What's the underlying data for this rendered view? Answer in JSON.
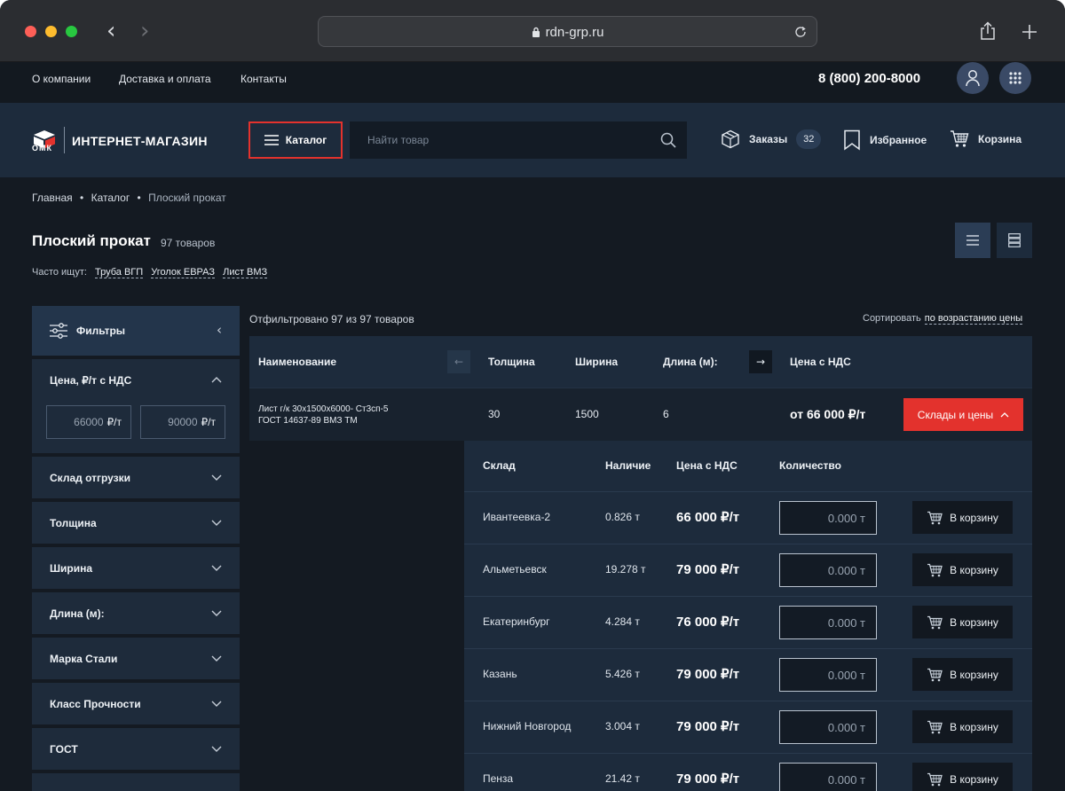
{
  "browser": {
    "url": "rdn-grp.ru"
  },
  "topbar": {
    "links": [
      "О компании",
      "Доставка и оплата",
      "Контакты"
    ],
    "phone": "8 (800) 200-8000"
  },
  "header": {
    "logo_abbr": "ОМК",
    "logo_text": "ИНТЕРНЕТ-МАГАЗИН",
    "catalog_label": "Каталог",
    "search_placeholder": "Найти товар",
    "orders_label": "Заказы",
    "orders_count": "32",
    "favorites_label": "Избранное",
    "cart_label": "Корзина"
  },
  "breadcrumb": {
    "home": "Главная",
    "catalog": "Каталог",
    "current": "Плоский прокат",
    "sep": "•"
  },
  "page": {
    "title": "Плоский прокат",
    "count": "97 товаров",
    "often_label": "Часто ищут:",
    "often_tags": [
      "Труба ВГП",
      "Уголок ЕВРАЗ",
      "Лист ВМЗ"
    ]
  },
  "sidebar": {
    "filters_label": "Фильтры",
    "price_label": "Цена, ₽/т с НДС",
    "price_from": "66000",
    "price_to": "90000",
    "price_unit": "₽/т",
    "groups": [
      "Склад отгрузки",
      "Толщина",
      "Ширина",
      "Длина (м):",
      "Марка Стали",
      "Класс Прочности",
      "ГОСТ"
    ]
  },
  "results": {
    "filtered_text": "Отфильтровано 97 из 97 товаров",
    "sort_label": "Сортировать",
    "sort_value": "по возрастанию цены",
    "columns": {
      "name": "Наименование",
      "thickness": "Толщина",
      "width": "Ширина",
      "length": "Длина (м):",
      "price": "Цена с НДС"
    },
    "product": {
      "name_line1": "Лист г/к 30х1500х6000- Ст3сп-5",
      "name_line2": "ГОСТ 14637-89 ВМЗ ТМ",
      "thickness": "30",
      "width": "1500",
      "length": "6",
      "price": "от 66 000 ₽/т",
      "stock_button": "Склады и цены"
    }
  },
  "stock": {
    "columns": {
      "warehouse": "Склад",
      "availability": "Наличие",
      "price": "Цена с НДС",
      "quantity": "Количество"
    },
    "cart_button": "В корзину",
    "rows": [
      {
        "warehouse": "Ивантеевка-2",
        "availability": "0.826 т",
        "price": "66 000 ₽/т",
        "quantity": "0.000 т"
      },
      {
        "warehouse": "Альметьевск",
        "availability": "19.278 т",
        "price": "79 000 ₽/т",
        "quantity": "0.000 т"
      },
      {
        "warehouse": "Екатеринбург",
        "availability": "4.284 т",
        "price": "76 000 ₽/т",
        "quantity": "0.000 т"
      },
      {
        "warehouse": "Казань",
        "availability": "5.426 т",
        "price": "79 000 ₽/т",
        "quantity": "0.000 т"
      },
      {
        "warehouse": "Нижний Новгород",
        "availability": "3.004 т",
        "price": "79 000 ₽/т",
        "quantity": "0.000 т"
      },
      {
        "warehouse": "Пенза",
        "availability": "21.42 т",
        "price": "79 000 ₽/т",
        "quantity": "0.000 т"
      }
    ]
  },
  "colors": {
    "accent_red": "#e3322d",
    "panel": "#1d2b3c",
    "background": "#141a22"
  }
}
